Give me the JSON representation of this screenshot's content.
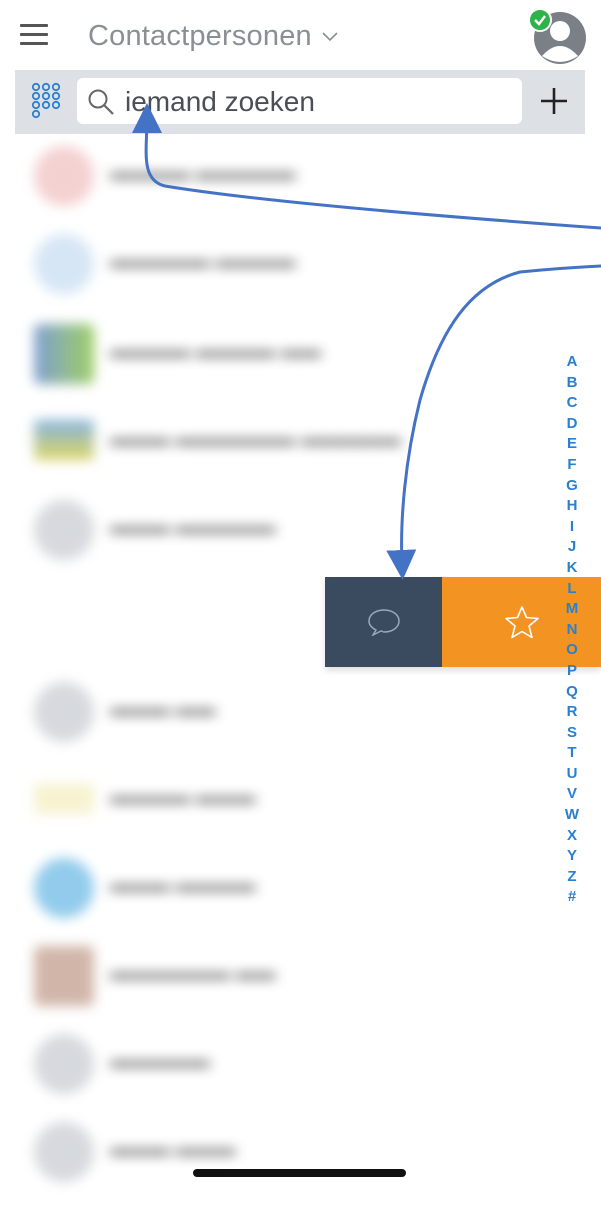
{
  "header": {
    "title": "Contactpersonen",
    "menu_icon": "hamburger-icon",
    "dropdown_icon": "chevron-down-icon",
    "avatar_icon": "user-avatar-icon",
    "status_color": "#2db34a"
  },
  "search": {
    "placeholder": "iemand zoeken",
    "dialpad_icon": "dialpad-icon",
    "search_icon": "search-icon",
    "add_icon": "plus-icon"
  },
  "alphabet": [
    "A",
    "B",
    "C",
    "D",
    "E",
    "F",
    "G",
    "H",
    "I",
    "J",
    "K",
    "L",
    "M",
    "N",
    "O",
    "P",
    "Q",
    "R",
    "S",
    "T",
    "U",
    "V",
    "W",
    "X",
    "Y",
    "Z",
    "#"
  ],
  "swipe_actions": {
    "chat_icon": "chat-bubble-icon",
    "favorite_icon": "star-icon",
    "chat_color": "#3a4a5f",
    "favorite_color": "#f39322"
  },
  "colors": {
    "accent": "#2a7fd0",
    "annotation_arrow": "#4472c4"
  }
}
